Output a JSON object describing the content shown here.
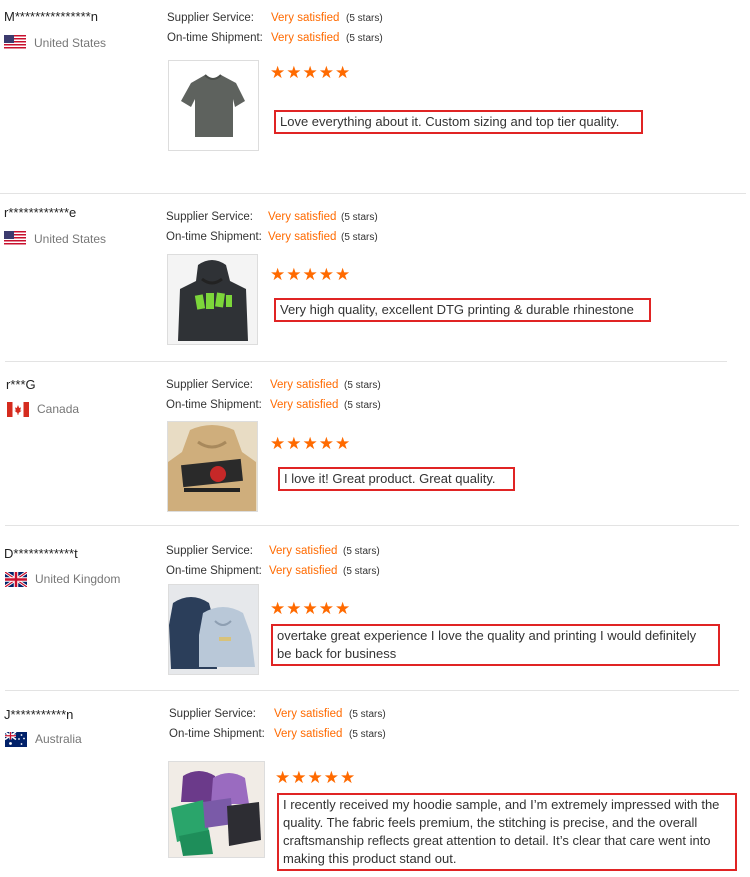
{
  "labels": {
    "supplier_service": "Supplier Service:",
    "on_time_shipment": "On-time Shipment:"
  },
  "colors": {
    "accent": "#ff6a00",
    "highlight_border": "#e02424"
  },
  "reviews": [
    {
      "reviewer": "M***************n",
      "country": "United States",
      "flag": "us-flag-icon",
      "supplier_service": "Very satisfied",
      "supplier_service_stars": "(5 stars)",
      "on_time_shipment": "Very satisfied",
      "on_time_shipment_stars": "(5 stars)",
      "rating": 5,
      "stars": "★★★★★",
      "product_image": "gray t-shirt",
      "comment": "Love everything about it. Custom sizing and top tier quality."
    },
    {
      "reviewer": "r************e",
      "country": "United States",
      "flag": "us-flag-icon",
      "supplier_service": "Very satisfied",
      "supplier_service_stars": "(5 stars)",
      "on_time_shipment": "Very satisfied",
      "on_time_shipment_stars": "(5 stars)",
      "rating": 5,
      "stars": "★★★★★",
      "product_image": "black hoodie with green print",
      "comment": "Very high quality, excellent DTG printing & durable rhinestone"
    },
    {
      "reviewer": "r***G",
      "country": "Canada",
      "flag": "canada-flag-icon",
      "supplier_service": "Very satisfied",
      "supplier_service_stars": "(5 stars)",
      "on_time_shipment": "Very satisfied",
      "on_time_shipment_stars": "(5 stars)",
      "rating": 5,
      "stars": "★★★★★",
      "product_image": "tan hoodie with graphic print",
      "comment": "I love it! Great product. Great quality."
    },
    {
      "reviewer": "D************t",
      "country": "United Kingdom",
      "flag": "uk-flag-icon",
      "supplier_service": "Very satisfied",
      "supplier_service_stars": "(5 stars)",
      "on_time_shipment": "Very satisfied",
      "on_time_shipment_stars": "(5 stars)",
      "rating": 5,
      "stars": "★★★★★",
      "product_image": "blue hoodies",
      "comment": "overtake great experience I love the quality and printing I would definitely be back for business"
    },
    {
      "reviewer": "J***********n",
      "country": "Australia",
      "flag": "australia-flag-icon",
      "supplier_service": "Very satisfied",
      "supplier_service_stars": "(5 stars)",
      "on_time_shipment": "Very satisfied",
      "on_time_shipment_stars": "(5 stars)",
      "rating": 5,
      "stars": "★★★★★",
      "product_image": "assorted hoodie samples",
      "comment": "I recently received my hoodie sample, and I’m extremely impressed with the quality. The fabric feels premium, the stitching is precise, and the overall craftsmanship reflects great attention to detail. It’s clear that care went into making this product stand out."
    }
  ]
}
